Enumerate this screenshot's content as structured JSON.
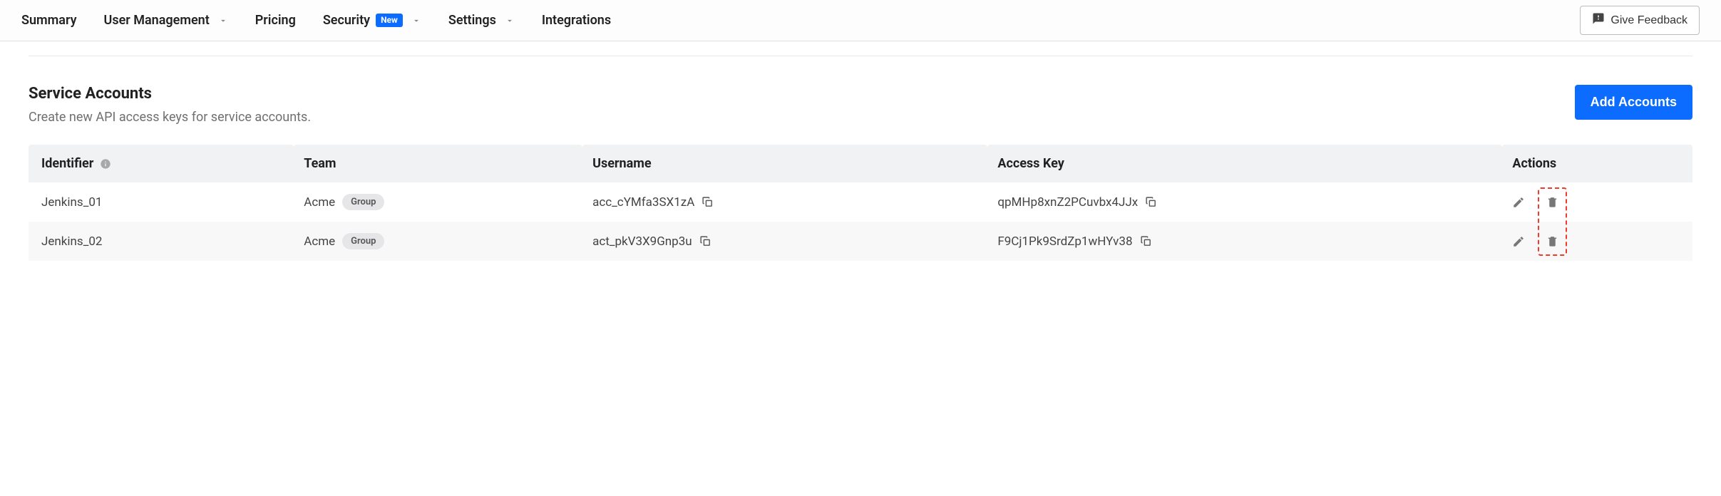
{
  "nav": {
    "summary": "Summary",
    "user_management": "User Management",
    "pricing": "Pricing",
    "security": "Security",
    "security_badge": "New",
    "settings": "Settings",
    "integrations": "Integrations"
  },
  "feedback_label": "Give Feedback",
  "section": {
    "title": "Service Accounts",
    "description": "Create new API access keys for service accounts.",
    "add_button": "Add Accounts"
  },
  "table": {
    "headers": {
      "identifier": "Identifier",
      "team": "Team",
      "username": "Username",
      "access_key": "Access Key",
      "actions": "Actions"
    },
    "group_chip": "Group",
    "rows": [
      {
        "identifier": "Jenkins_01",
        "team": "Acme",
        "username": "acc_cYMfa3SX1zA",
        "access_key": "qpMHp8xnZ2PCuvbx4JJx"
      },
      {
        "identifier": "Jenkins_02",
        "team": "Acme",
        "username": "act_pkV3X9Gnp3u",
        "access_key": "F9Cj1Pk9SrdZp1wHYv38"
      }
    ]
  }
}
